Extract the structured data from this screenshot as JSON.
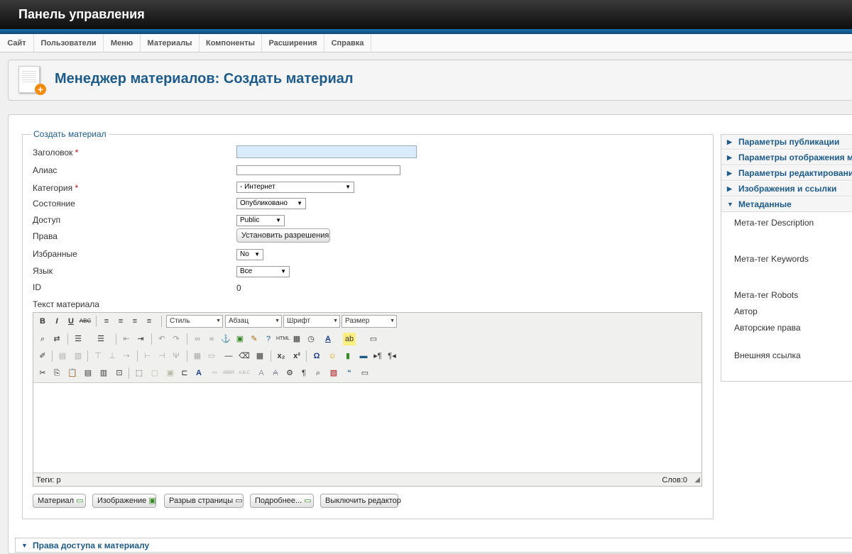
{
  "app": {
    "title": "Панель управления"
  },
  "menu": [
    "Сайт",
    "Пользователи",
    "Меню",
    "Материалы",
    "Компоненты",
    "Расширения",
    "Справка"
  ],
  "page": {
    "title": "Менеджер материалов: Создать материал"
  },
  "form": {
    "legend": "Создать материал",
    "title_label": "Заголовок",
    "required_mark": "*",
    "alias_label": "Алиас",
    "category_label": "Категория",
    "category_value": "- Интернет",
    "state_label": "Состояние",
    "state_value": "Опубликовано",
    "access_label": "Доступ",
    "access_value": "Public",
    "rights_label": "Права",
    "rights_button": "Установить разрешения",
    "featured_label": "Избранные",
    "featured_value": "No",
    "language_label": "Язык",
    "language_value": "Все",
    "id_label": "ID",
    "id_value": "0",
    "text_label": "Текст материала"
  },
  "editor": {
    "style_select": "Стиль",
    "format_select": "Абзац",
    "font_select": "Шрифт",
    "size_select": "Размер",
    "path": "Теги: p",
    "word_count": "Слов:0"
  },
  "buttons": [
    "Материал",
    "Изображение",
    "Разрыв страницы",
    "Подробнее...",
    "Выключить редактор"
  ],
  "sidebar": {
    "panels": [
      "Параметры публикации",
      "Параметры отображения м",
      "Параметры редактировани",
      "Изображения и ссылки",
      "Метаданные"
    ],
    "meta_fields": [
      "Мета-тег Description",
      "Мета-тег Keywords",
      "Мета-тег Robots",
      "Автор",
      "Авторские права",
      "Внешняя ссылка"
    ]
  },
  "bottom_panel": "Права доступа к материалу",
  "colors": {
    "accent": "#1c5b8a",
    "topbar": "#1a1a1a",
    "title_input": "#d9ecfb"
  }
}
